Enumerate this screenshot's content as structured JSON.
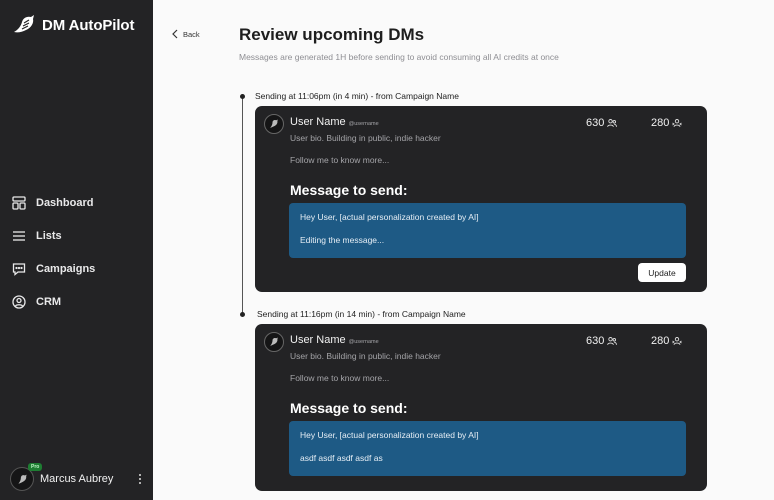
{
  "app": {
    "brand": "DM AutoPilot"
  },
  "sidebar": {
    "items": [
      {
        "label": "Dashboard",
        "icon": "dashboard-icon"
      },
      {
        "label": "Lists",
        "icon": "list-icon"
      },
      {
        "label": "Campaigns",
        "icon": "chat-icon"
      },
      {
        "label": "CRM",
        "icon": "user-circle-icon"
      }
    ],
    "user": {
      "name": "Marcus Aubrey",
      "badge": "Pro"
    }
  },
  "header": {
    "back_label": "Back",
    "title": "Review upcoming DMs",
    "subtitle": "Messages are generated 1H before sending to avoid consuming all AI credits at once"
  },
  "dms": [
    {
      "slot_label": "Sending at 11:06pm (in 4 min) - from Campaign Name",
      "user_name": "User Name",
      "handle": "@username",
      "bio": "User bio. Building in public, indie hacker",
      "follow": "Follow me to know more...",
      "followers": "630",
      "following": "280",
      "message_heading": "Message to send:",
      "message_line1": "Hey User, [actual personalization created by AI]",
      "message_line2": "Editing the message...",
      "update_label": "Update"
    },
    {
      "slot_label": "Sending at 11:16pm (in 14 min) - from Campaign Name",
      "user_name": "User Name",
      "handle": "@username",
      "bio": "User bio. Building in public, indie hacker",
      "follow": "Follow me to know more...",
      "followers": "630",
      "following": "280",
      "message_heading": "Message to send:",
      "message_line1": "Hey User, [actual personalization created by AI]",
      "message_line2": "asdf asdf asdf asdf as"
    }
  ],
  "colors": {
    "sidebar": "#232325",
    "card": "#232325",
    "message_box": "#1e5a85",
    "pro_badge": "#1e7d32"
  }
}
